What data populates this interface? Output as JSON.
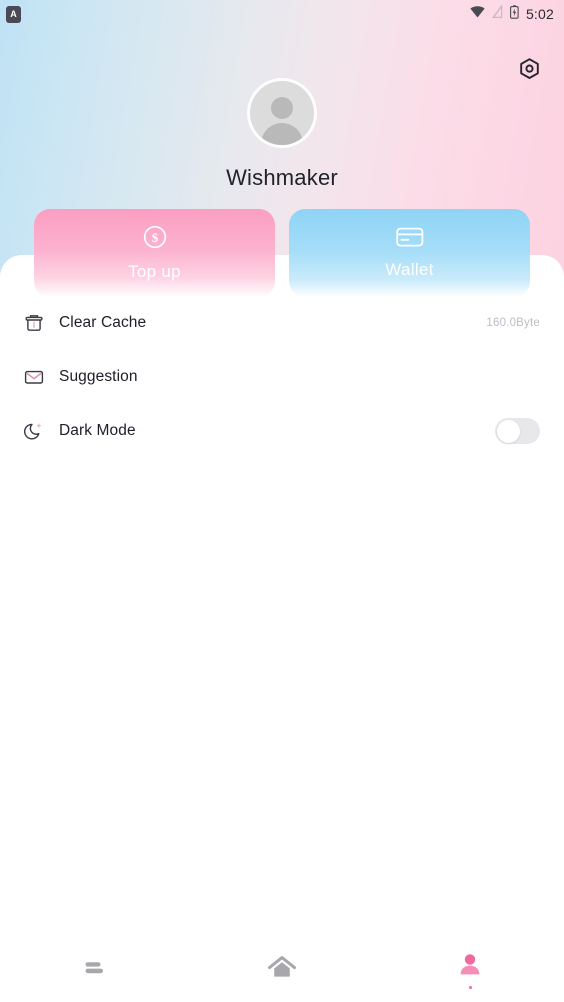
{
  "statusbar": {
    "app_badge_letter": "A",
    "time": "5:02",
    "icons": [
      "wifi-icon",
      "signal-off-icon",
      "battery-charging-icon"
    ]
  },
  "header": {
    "settings_icon": "gear-icon"
  },
  "profile": {
    "avatar_icon": "default-avatar-icon",
    "username": "Wishmaker"
  },
  "actions": [
    {
      "key": "topup",
      "label": "Top up",
      "icon": "dollar-circle-icon",
      "color": "#fb9ec2"
    },
    {
      "key": "wallet",
      "label": "Wallet",
      "icon": "credit-card-icon",
      "color": "#8fd4f6"
    }
  ],
  "list": [
    {
      "key": "clear_cache",
      "label": "Clear Cache",
      "icon": "trash-icon",
      "value": "160.0Byte"
    },
    {
      "key": "suggestion",
      "label": "Suggestion",
      "icon": "envelope-icon",
      "value": ""
    },
    {
      "key": "dark_mode",
      "label": "Dark Mode",
      "icon": "moon-icon",
      "toggle": "off"
    }
  ],
  "bottom_nav": [
    {
      "key": "list",
      "icon": "list-icon",
      "active": false,
      "color": "#a8a8ac"
    },
    {
      "key": "home",
      "icon": "home-icon",
      "active": false,
      "color": "#a8a8ac"
    },
    {
      "key": "profile",
      "icon": "person-icon",
      "active": true,
      "color": "#f06aa0"
    }
  ],
  "theme": {
    "bg_left": "#bfe2f5",
    "bg_right": "#fbcfdf",
    "sheet": "#ffffff",
    "accent_pink": "#f06aa0",
    "text_primary": "#20202a",
    "text_muted": "#bdbdc4"
  }
}
